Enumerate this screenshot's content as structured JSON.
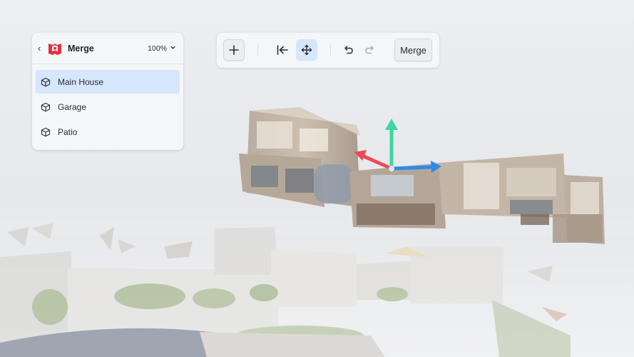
{
  "panel": {
    "back_icon": "chevron-left-icon",
    "logo_icon": "matterport-logo",
    "title": "Merge",
    "zoom_value": "100%",
    "zoom_icon": "chevron-down-icon",
    "items": [
      {
        "label": "Main House",
        "icon": "cube-icon",
        "selected": true
      },
      {
        "label": "Garage",
        "icon": "cube-icon",
        "selected": false
      },
      {
        "label": "Patio",
        "icon": "cube-icon",
        "selected": false
      }
    ]
  },
  "toolbar": {
    "add_icon": "plus-icon",
    "collapse_icon": "arrow-left-to-line-icon",
    "move_icon": "move-arrows-icon",
    "undo_icon": "undo-icon",
    "redo_icon": "redo-icon",
    "merge_label": "Merge"
  },
  "gizmo": {
    "x_axis_color": "#2f8ce6",
    "y_axis_color": "#3dd6a0",
    "z_axis_color": "#ee4a56"
  },
  "colors": {
    "accent_selected": "#d6e6fb",
    "logo_red": "#e2323f"
  }
}
